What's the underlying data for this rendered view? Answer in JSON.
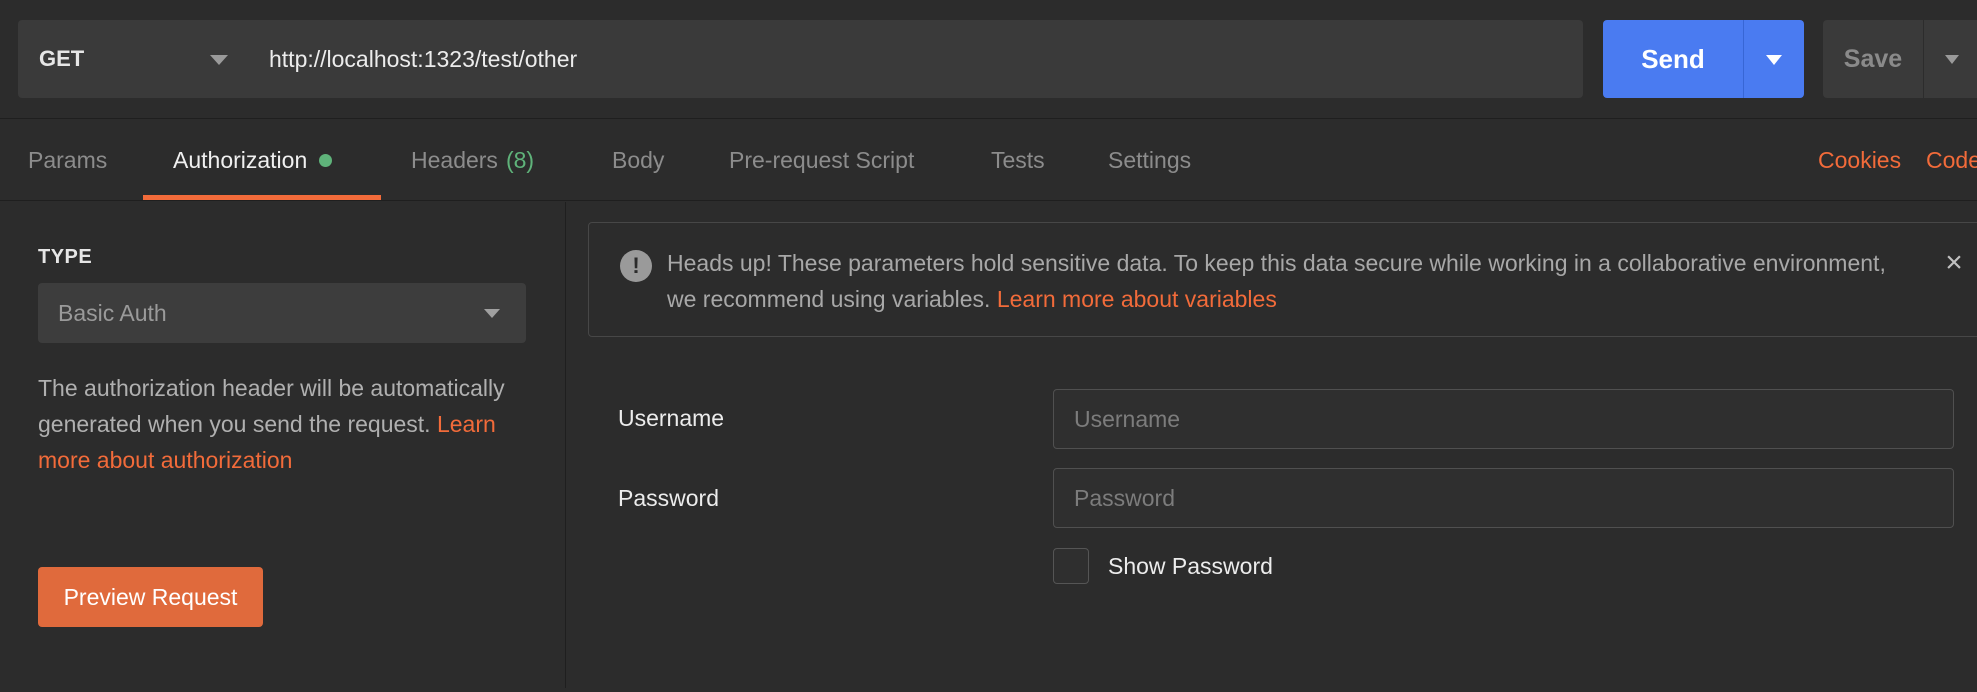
{
  "request": {
    "method": "GET",
    "url": "http://localhost:1323/test/other",
    "send_label": "Send",
    "save_label": "Save"
  },
  "tabs": [
    {
      "label": "Params"
    },
    {
      "label": "Authorization",
      "active": true,
      "indicator": "green-dot"
    },
    {
      "label": "Headers",
      "count": "(8)"
    },
    {
      "label": "Body"
    },
    {
      "label": "Pre-request Script"
    },
    {
      "label": "Tests"
    },
    {
      "label": "Settings"
    }
  ],
  "right_links": {
    "cookies": "Cookies",
    "code": "Code"
  },
  "auth": {
    "type_label": "TYPE",
    "type_value": "Basic Auth",
    "description": "The authorization header will be automatically generated when you send the request.",
    "description_link": "Learn more about authorization",
    "preview_button": "Preview Request"
  },
  "notice": {
    "text": "Heads up! These parameters hold sensitive data. To keep this data secure while working in a collaborative environment, we recommend using variables.",
    "link": "Learn more about variables",
    "icon": "exclamation-circle-icon",
    "close_icon": "close-icon"
  },
  "form": {
    "username_label": "Username",
    "username_placeholder": "Username",
    "password_label": "Password",
    "password_placeholder": "Password",
    "show_password_label": "Show Password"
  },
  "colors": {
    "accent": "#f26b3a",
    "send": "#4a7bf1",
    "indicator": "#5fb37a",
    "background": "#2c2c2c"
  }
}
